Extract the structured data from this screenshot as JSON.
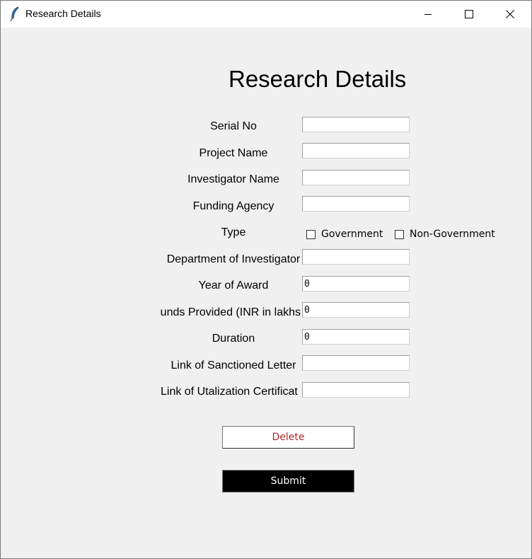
{
  "window": {
    "title": "Research Details",
    "controls": [
      "minimize",
      "maximize",
      "close"
    ]
  },
  "form": {
    "heading": "Research Details",
    "fields": {
      "serial_no": {
        "label": "Serial No",
        "value": ""
      },
      "project_name": {
        "label": "Project Name",
        "value": ""
      },
      "investigator_name": {
        "label": "Investigator Name",
        "value": ""
      },
      "funding_agency": {
        "label": "Funding Agency",
        "value": ""
      },
      "type": {
        "label": "Type",
        "options": [
          {
            "label": "Government",
            "checked": false
          },
          {
            "label": "Non-Government",
            "checked": false
          }
        ]
      },
      "department": {
        "label": "Department of Investigator",
        "value": ""
      },
      "year_of_award": {
        "label": "Year of Award",
        "value": "0"
      },
      "funds_provided": {
        "label": "Funds Provided (INR in lakhs",
        "value": "0"
      },
      "duration": {
        "label": "Duration",
        "value": "0"
      },
      "sanctioned_letter": {
        "label": "Link of Sanctioned Letter",
        "value": ""
      },
      "utilization_certificate": {
        "label": "Link of Utalization Certificat",
        "value": ""
      }
    },
    "buttons": {
      "delete": {
        "label": "Delete",
        "color": "#b12a2a"
      },
      "submit": {
        "label": "Submit",
        "background": "#000000"
      }
    }
  }
}
